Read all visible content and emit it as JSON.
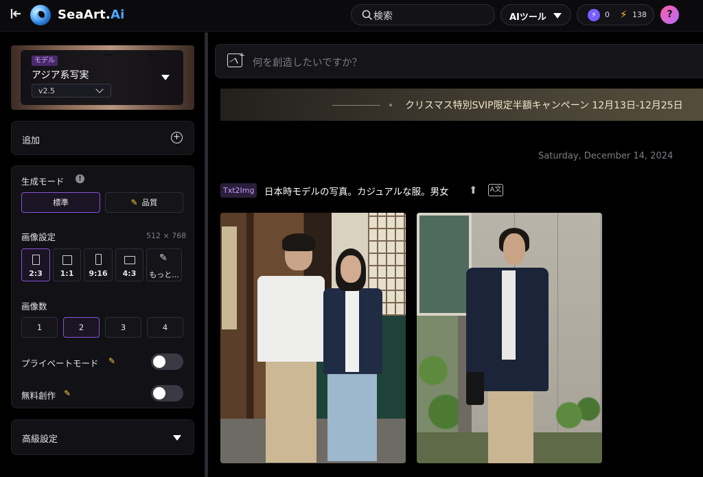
{
  "header": {
    "brand_name": "SeaArt.",
    "brand_suffix": "Ai",
    "search_label": "検索",
    "ai_tools_label": "AIツール",
    "credit_a": "0",
    "credit_b": "138",
    "help_label": "?"
  },
  "sidebar": {
    "model": {
      "tag": "モデル",
      "name": "アジア系写実",
      "version": "v2.5"
    },
    "add_label": "追加",
    "generation_mode": {
      "title": "生成モード",
      "options": [
        "標準",
        "品質"
      ],
      "selected": "標準"
    },
    "image_settings": {
      "title": "画像設定",
      "size": "512 × 768",
      "ratios": [
        "2:3",
        "1:1",
        "9:16",
        "4:3",
        "もっと..."
      ],
      "selected": "2:3"
    },
    "image_count": {
      "title": "画像数",
      "options": [
        "1",
        "2",
        "3",
        "4"
      ],
      "selected": "2"
    },
    "private_mode": {
      "label": "プライベートモード",
      "enabled": false
    },
    "free_creation": {
      "label": "無料創作",
      "enabled": false
    },
    "advanced_label": "高級設定"
  },
  "main": {
    "prompt_placeholder": "何を創造したいですか？",
    "banner_text": "クリスマス特別SVIP限定半額キャンペーン 12月13日-12月25日",
    "date": "Saturday, December 14, 2024",
    "task": {
      "tag": "Txt2Img",
      "prompt": "日本時モデルの写真。カジュアルな服。男女"
    }
  },
  "colors": {
    "accent": "#8a52d8",
    "brand_blue": "#4ea8ff",
    "background": "#000000",
    "panel": "#111116"
  }
}
